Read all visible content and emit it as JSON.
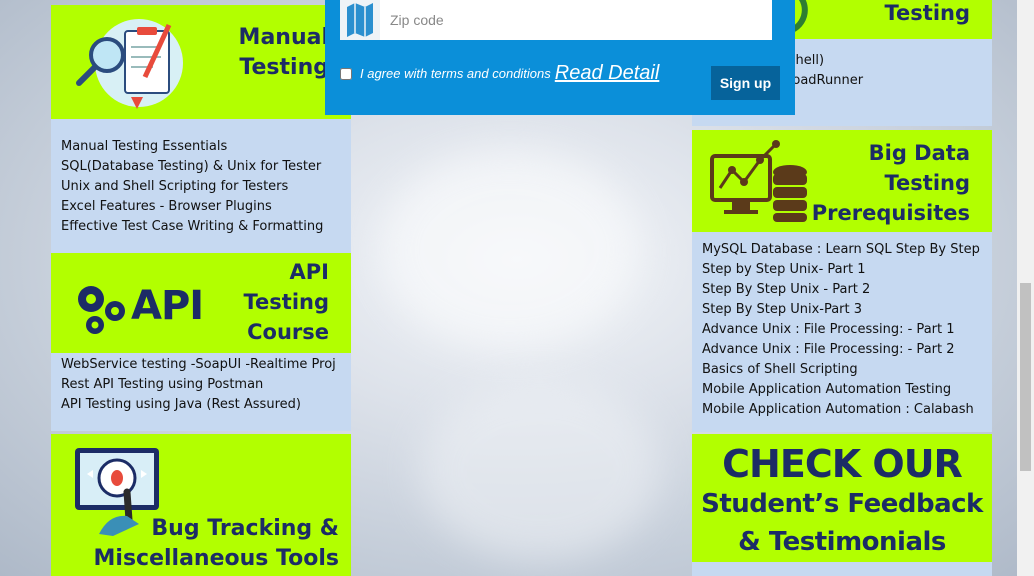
{
  "popup": {
    "zip_placeholder": "Zip code",
    "agree_text": "I agree with terms and conditions",
    "read_detail": "Read Detail",
    "signup_label": "Sign up"
  },
  "manual": {
    "title_lines": [
      "Manual",
      "Testing"
    ],
    "items": [
      "Manual Testing Essentials",
      "SQL(Database Testing) & Unix for Tester",
      "Unix and Shell Scripting for Testers",
      "Excel Features - Browser Plugins",
      "Effective Test Case Writing & Formatting"
    ]
  },
  "api": {
    "logo_text": "API",
    "title_lines": [
      "API",
      "Testing",
      "Course"
    ],
    "items": [
      "WebService testing -SoapUI -Realtime Proj",
      "Rest API Testing using Postman",
      "API Testing using Java (Rest Assured)"
    ]
  },
  "bug": {
    "title_lines": [
      "Bug Tracking &",
      "Miscellaneous Tools"
    ]
  },
  "perf": {
    "title": "Testing",
    "items": [
      "Jmeter (BeanShell)",
      "esting using LoadRunner"
    ]
  },
  "bigdata": {
    "title_lines": [
      "Big Data",
      "Testing",
      "Prerequisites"
    ],
    "items": [
      "MySQL Database : Learn SQL Step By Step",
      "Step by Step Unix- Part 1",
      "Step By Step Unix - Part 2",
      "Step By Step Unix-Part 3",
      "Advance Unix : File Processing:  - Part 1",
      "Advance Unix : File Processing:  - Part 2",
      "Basics of Shell Scripting",
      "Mobile Application Automation Testing",
      "Mobile Application Automation : Calabash"
    ]
  },
  "feedback": {
    "lines": [
      "CHECK OUR",
      "Student’s Feedback",
      "& Testimonials"
    ]
  },
  "colors": {
    "head_green": "#b2ff00",
    "list_blue": "#c6d9f1",
    "title_navy": "#1c2c66",
    "popup_blue": "#0b8fd9"
  }
}
